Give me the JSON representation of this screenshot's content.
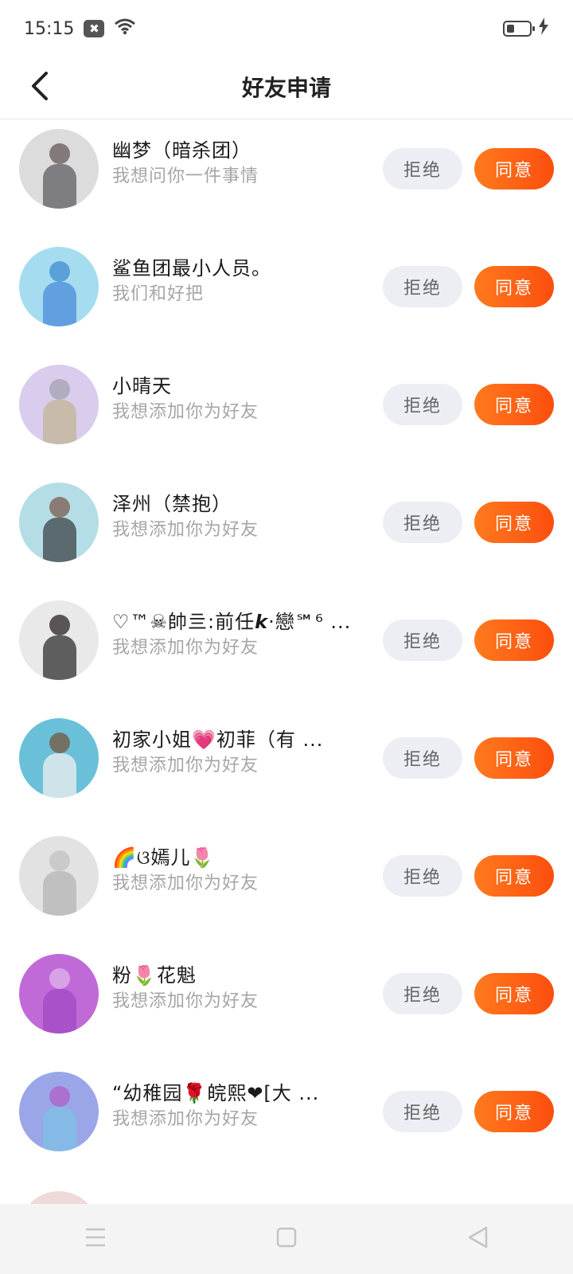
{
  "status_bar": {
    "time": "15:15",
    "notif_glyph": "✖",
    "icons": [
      "close-notification-icon",
      "wifi-icon",
      "battery-icon",
      "charging-icon"
    ]
  },
  "header": {
    "title": "好友申请",
    "back_icon": "chevron-left-icon"
  },
  "buttons": {
    "reject": "拒绝",
    "accept": "同意"
  },
  "colors": {
    "accent_start": "#ff7a1e",
    "accent_end": "#fc4e0e",
    "reject_bg": "#eceef3",
    "secondary_text": "#a6a6a6"
  },
  "requests": [
    {
      "name": "幽梦（暗杀团）",
      "message": "我想问你一件事情",
      "avatar_bg": "#dcdcdc"
    },
    {
      "name": "鲨鱼团最小人员。",
      "message": "我们和好把",
      "avatar_bg": "#a6dcef"
    },
    {
      "name": "小晴天",
      "message": "我想添加你为好友",
      "avatar_bg": "#d9ccec"
    },
    {
      "name": "泽州（禁抱）",
      "message": "我想添加你为好友",
      "avatar_bg": "#b5dde6"
    },
    {
      "name": "♡™☠帥亖:前任𝙠·戀℠⁶ ...",
      "message": "我想添加你为好友",
      "avatar_bg": "#e9e9e9"
    },
    {
      "name": "初家小姐💗初菲（有 ...",
      "message": "我想添加你为好友",
      "avatar_bg": "#6ac0d8"
    },
    {
      "name": "🌈ଓ嫣儿🌷",
      "message": "我想添加你为好友",
      "avatar_bg": "#e2e2e2"
    },
    {
      "name": "粉🌷花魁",
      "message": "我想添加你为好友",
      "avatar_bg": "#c06ad8"
    },
    {
      "name": "“幼稚园🌹皖熙❤[大 ...",
      "message": "我想添加你为好友",
      "avatar_bg": "#9aa6e8"
    }
  ],
  "bottom_nav": {
    "items": [
      "menu-icon",
      "home-square-icon",
      "back-triangle-icon"
    ]
  }
}
